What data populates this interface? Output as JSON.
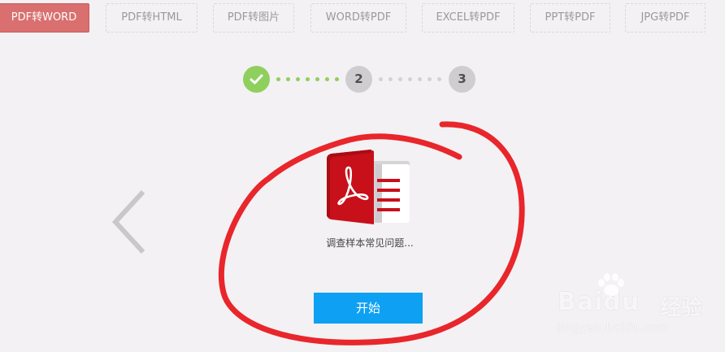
{
  "tabs": [
    {
      "label": "PDF转WORD",
      "active": true
    },
    {
      "label": "PDF转HTML",
      "active": false
    },
    {
      "label": "PDF转图片",
      "active": false
    },
    {
      "label": "WORD转PDF",
      "active": false
    },
    {
      "label": "EXCEL转PDF",
      "active": false
    },
    {
      "label": "PPT转PDF",
      "active": false
    },
    {
      "label": "JPG转PDF",
      "active": false
    }
  ],
  "steps": [
    {
      "label": "",
      "state": "done",
      "icon": "check-icon"
    },
    {
      "label": "2",
      "state": "pending"
    },
    {
      "label": "3",
      "state": "pending"
    }
  ],
  "file": {
    "name": "调查样本常见问题...",
    "icon": "pdf-file-icon"
  },
  "start_button": {
    "label": "开始"
  },
  "navigation": {
    "prev_icon": "chevron-left-icon"
  },
  "watermark": {
    "brand": "Baidu",
    "product": "经验",
    "url": "jingyan.baidu.com"
  },
  "colors": {
    "background": "#f3f1f3",
    "tab_active": "#d9706f",
    "step_done": "#8fcf5e",
    "step_pending": "#cfcdcf",
    "dots_done": "#8fcf5e",
    "dots_pending": "#d3d1d3",
    "start_button": "#0ea0f2",
    "pdf_red": "#c8101a",
    "annotation_red": "#e8262b"
  }
}
